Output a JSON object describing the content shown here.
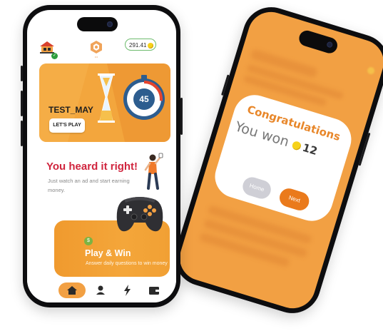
{
  "back_phone": {
    "modal": {
      "title": "Congratulations",
      "won_text": "You won",
      "amount": "12",
      "home_button": "Home",
      "next_button": "Next"
    }
  },
  "front_phone": {
    "header": {
      "balance": "291.41"
    },
    "banner": {
      "title": "TEST_MAY",
      "button_label": "LET'S PLAY",
      "timer_value": "45",
      "active_slide": 1
    },
    "promo": {
      "heading": "You heard it right!",
      "subtext": "Just watch an ad and start earning money."
    },
    "play_card": {
      "badge": "$",
      "title": "Play & Win",
      "subtitle": "Answer daily questions to win money"
    },
    "bottom_nav": {
      "items": [
        "home-icon",
        "profile-icon",
        "lightning-icon",
        "wallet-icon"
      ],
      "active": "home-icon"
    }
  },
  "colors": {
    "brand_orange": "#f2a043",
    "accent_red": "#d0253e",
    "next_button": "#ea7a1c"
  }
}
